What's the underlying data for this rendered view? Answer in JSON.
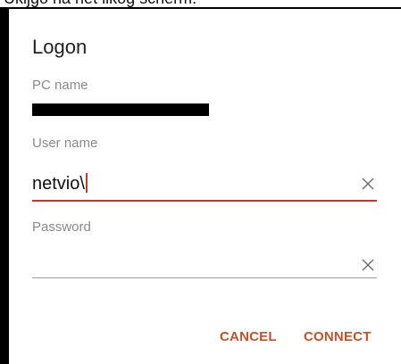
{
  "top_text": "Ukljgo na het likog scherm:",
  "dialog": {
    "title": "Logon",
    "pc_name": {
      "label": "PC name"
    },
    "user_name": {
      "label": "User name",
      "value": "netvio\\"
    },
    "password": {
      "label": "Password",
      "value": ""
    },
    "buttons": {
      "cancel": "CANCEL",
      "connect": "CONNECT"
    }
  },
  "colors": {
    "accent": "#c0392b",
    "button_text": "#b8542f",
    "label": "#8a8a8a",
    "frame": "#000000"
  },
  "icons": {
    "clear": "close-x-icon"
  }
}
